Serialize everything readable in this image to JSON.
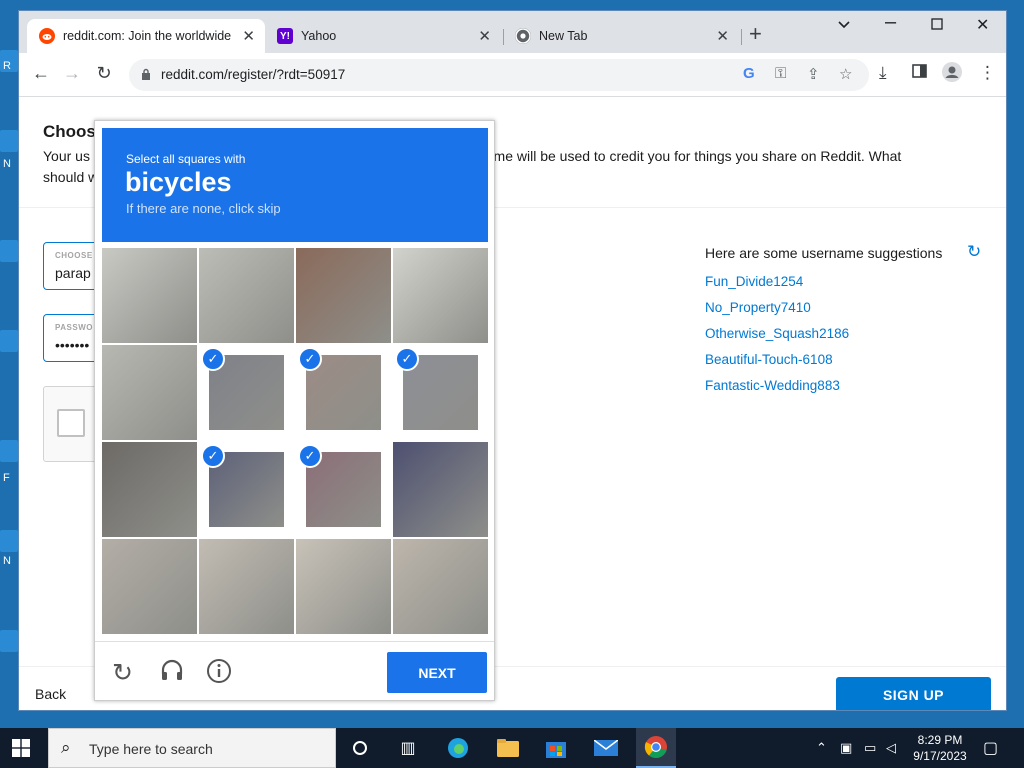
{
  "desktop": {
    "labels": [
      "R",
      "N",
      "F",
      "N"
    ]
  },
  "browser": {
    "tabs": [
      {
        "title": "reddit.com: Join the worldwide conversation",
        "favicon": "reddit-icon"
      },
      {
        "title": "Yahoo",
        "favicon": "yahoo-icon",
        "favicon_text": "Y!"
      },
      {
        "title": "New Tab",
        "favicon": "chrome-icon"
      }
    ],
    "url": "reddit.com/register/?rdt=50917"
  },
  "page": {
    "heading": "Choos",
    "description": "Your us                                                                               name will be used to credit you for things you share on Reddit. What should w",
    "desc_line1_left": "Your us",
    "desc_line1_right": "name will be used to credit you for things you share on Reddit. What",
    "desc_line2": "should w",
    "username_field": {
      "label": "CHOOSE",
      "value": "parap"
    },
    "password_field": {
      "label": "PASSWO",
      "value": "•••••••"
    },
    "suggestions_title": "Here are some username suggestions",
    "suggestions": [
      "Fun_Divide1254",
      "No_Property7410",
      "Otherwise_Squash2186",
      "Beautiful-Touch-6108",
      "Fantastic-Wedding883"
    ],
    "back_label": "Back",
    "signup_label": "SIGN UP"
  },
  "captcha": {
    "prompt": "Select all squares with",
    "object": "bicycles",
    "hint": "If there are none, click skip",
    "grid": [
      [
        false,
        false,
        false,
        false
      ],
      [
        false,
        true,
        true,
        true
      ],
      [
        false,
        true,
        true,
        false
      ],
      [
        false,
        false,
        false,
        false
      ]
    ],
    "next_label": "NEXT"
  },
  "taskbar": {
    "search_placeholder": "Type here to search",
    "time": "8:29 PM",
    "date": "9/17/2023"
  },
  "colors": {
    "reddit_blue": "#0079d3",
    "captcha_blue": "#1a73e8",
    "reddit_orange": "#ff4500",
    "yahoo_purple": "#6001d2"
  }
}
